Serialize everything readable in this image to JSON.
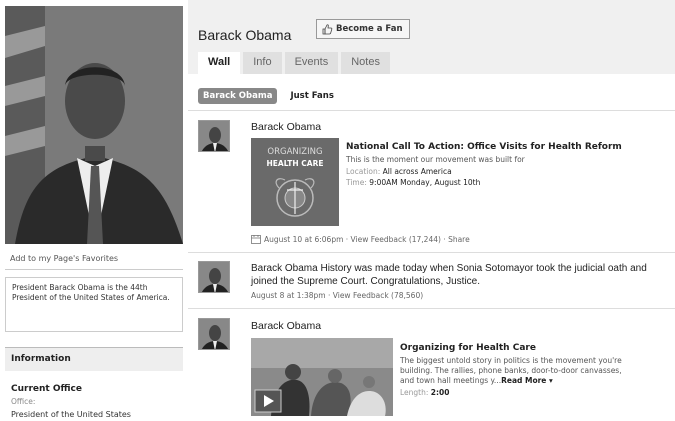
{
  "left": {
    "fav_link": "Add to my Page's Favorites",
    "bio": "President Barack Obama is the 44th President of the United States of America.",
    "info_header": "Information",
    "office_title": "Current Office",
    "office_label": "Office:",
    "office_value": "President of the United States"
  },
  "header": {
    "page_name": "Barack Obama",
    "fan_button": "Become a Fan"
  },
  "tabs": [
    "Wall",
    "Info",
    "Events",
    "Notes"
  ],
  "filters": [
    "Barack Obama",
    "Just Fans"
  ],
  "posts": [
    {
      "author": "Barack Obama",
      "attachment": {
        "image_line1": "ORGANIZING",
        "image_line2": "HEALTH CARE",
        "title": "National Call To Action: Office Visits for Health Reform",
        "description": "This is the moment our movement was built for",
        "location_label": "Location:",
        "location_value": "All across America",
        "time_label": "Time:",
        "time_value": "9:00AM Monday, August 10th"
      },
      "meta": "August 10 at 6:06pm · View Feedback (17,244) · Share"
    },
    {
      "author": "Barack Obama",
      "status": "History was made today when Sonia Sotomayor took the judicial oath and joined the Supreme Court. Congratulations, Justice.",
      "meta": "August 8 at 1:38pm · View Feedback (78,560)"
    },
    {
      "author": "Barack Obama",
      "attachment": {
        "title": "Organizing for Health Care",
        "description_1": "The biggest untold story in politics is the movement you're",
        "description_2": "building. The rallies, phone banks, door-to-door canvasses,",
        "description_3": "and town hall meetings y...",
        "read_more": "Read More ▾",
        "length_label": "Length:",
        "length_value": "2:00"
      }
    }
  ],
  "colors": {
    "accent": "#888888",
    "tab_bg": "#e0e0e0"
  }
}
